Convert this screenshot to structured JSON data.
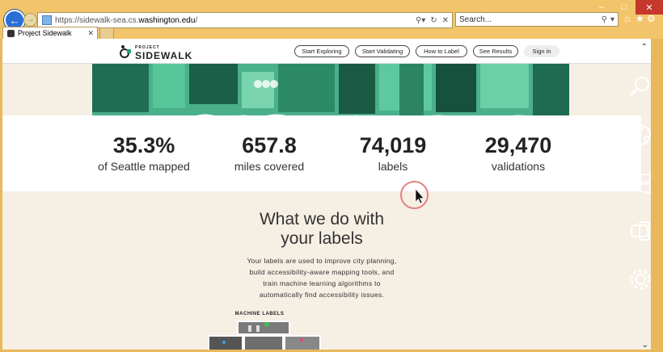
{
  "browser": {
    "address": {
      "prefix": "https://sidewalk-sea.cs.",
      "domain": "washington.edu",
      "suffix": "/"
    },
    "search_placeholder": "Search...",
    "tab_title": "Project Sidewalk"
  },
  "site": {
    "logo": {
      "small": "PROJECT",
      "big": "SIDEWALK"
    },
    "nav": [
      "Start Exploring",
      "Start Validating",
      "How to Label",
      "See Results",
      "Sign in"
    ]
  },
  "stats": [
    {
      "value": "35.3%",
      "label": "of Seattle mapped"
    },
    {
      "value": "657.8",
      "label": "miles covered"
    },
    {
      "value": "74,019",
      "label": "labels"
    },
    {
      "value": "29,470",
      "label": "validations"
    }
  ],
  "section": {
    "heading_line1": "What we do with",
    "heading_line2": "your labels",
    "blurb_lines": [
      "Your labels are used to improve city planning,",
      "build accessibility-aware mapping tools, and",
      "train machine learning algorithms to",
      "automatically find accessibility issues."
    ],
    "machine_labels": "MACHINE LABELS"
  },
  "charms": [
    "search-charm-icon",
    "share-charm-icon",
    "start-charm-icon",
    "devices-charm-icon",
    "settings-charm-icon"
  ],
  "colors": {
    "ie_frame": "#f3c56b",
    "hero_green": "#2f8f6d",
    "page_bg": "#f6efe4"
  }
}
